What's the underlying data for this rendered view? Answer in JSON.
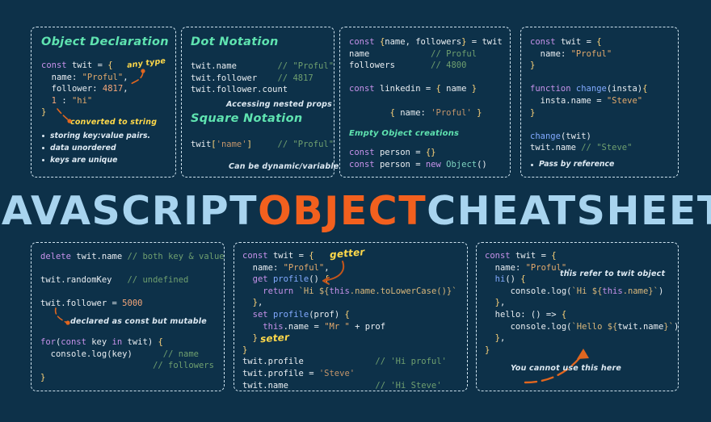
{
  "banner": {
    "word1": "JAVASCRIPT",
    "word2": "OBJECT",
    "word3": "CHEATSHEET",
    "color_blue": "#a8d4ef",
    "color_orange": "#f2601e"
  },
  "theme": {
    "background": "#0d3149",
    "card_border": "#cfe3ef",
    "annotation_yellow": "#ffd94a",
    "annotation_white": "#dde9f2",
    "heading_green": "#5fe3b0",
    "arrow_orange": "#e0661f"
  },
  "cards": {
    "object_declaration": {
      "heading": "Object Declaration",
      "code_lines": [
        "const twit = {",
        "  name: \"Proful\",",
        "  follower: 4817,",
        "  1 : \"hi\"",
        "}"
      ],
      "annotations": [
        {
          "name": "any-type",
          "text": "any type",
          "color": "yellow"
        },
        {
          "name": "converted-to-string",
          "text": "converted to string",
          "color": "yellow"
        }
      ],
      "bullets": [
        "storing key:value pairs.",
        "data unordered",
        "keys are unique"
      ]
    },
    "dot_notation": {
      "heading": "Dot Notation",
      "code_lines": [
        "twit.name          // \"Proful\"",
        "twit.follower      // 4817",
        "twit.follower.count"
      ],
      "annotation_nested": "Accessing nested props",
      "heading2": "Square Notation",
      "code_lines2": [
        "twit['name']     // \"Proful\""
      ],
      "annotation_dynamic": "Can be dynamic/variable"
    },
    "destructuring": {
      "code_lines": [
        "const {name, followers} = twit",
        "name              // Proful",
        "followers         // 4800",
        "",
        "const linkedin = { name }",
        "",
        "        { name: 'Proful' }"
      ],
      "annotation_empty": "Empty Object creations",
      "code_lines2": [
        "const person = {}",
        "const person = new Object()"
      ]
    },
    "pass_by_reference": {
      "code_lines": [
        "const twit = {",
        "  name: \"Proful\"",
        "}",
        "",
        "function change(insta){",
        "  insta.name = \"Steve\"",
        "}",
        "",
        "change(twit)",
        "twit.name // \"Steve\""
      ],
      "bullet": "Pass by reference"
    },
    "delete_and_loop": {
      "code_lines": [
        "delete twit.name // both key & value",
        "",
        "twit.randomKey   // undefined",
        "",
        "twit.follower = 5000"
      ],
      "annotation_mutable": "declared as const but mutable",
      "code_lines2": [
        "for(const key in twit) {",
        "  console.log(key)        // name",
        "                          // followers",
        "}"
      ]
    },
    "getter_setter": {
      "code_lines": [
        "const twit = {",
        "  name: \"Proful\",",
        "  get profile() {",
        "    return `Hi ${this.name.toLowerCase()}`",
        "  },",
        "  set profile(prof) {",
        "    this.name = \"Mr \" + prof",
        "  }",
        "}",
        "twit.profile              // 'Hi proful'",
        "twit.profile = 'Steve'",
        "twit.name                 // 'Hi Steve'"
      ],
      "annotation_getter": "getter",
      "annotation_setter": "seter"
    },
    "this_keyword": {
      "code_lines": [
        "const twit = {",
        "  name: \"Proful\",",
        "  hi() {",
        "    console.log(`Hi ${this.name}`)",
        "  },",
        "  hello: () => {",
        "    console.log(`Hello ${twit.name}`)",
        "  },",
        "}"
      ],
      "annotation_this_refer": "this refer to twit object",
      "annotation_cannot_use": "You cannot use this here"
    }
  }
}
